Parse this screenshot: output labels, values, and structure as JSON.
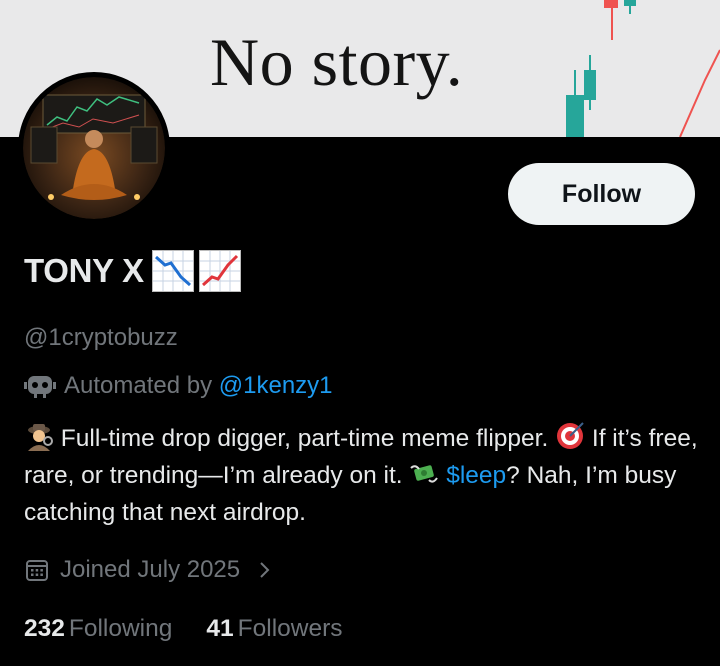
{
  "banner": {
    "text": "No story."
  },
  "profile": {
    "display_name": "TONY X",
    "name_emojis": [
      "chart-decreasing-icon",
      "chart-increasing-icon"
    ],
    "handle": "@1cryptobuzz",
    "automated_prefix": "Automated by",
    "automated_by": "@1kenzy1",
    "bio_part1": " Full-time drop digger, part-time meme flipper. ",
    "bio_part2": " If it’s free, rare, or trending—I’m already on it. ",
    "bio_link": "$leep",
    "bio_part3": "? Nah, I’m busy catching that next airdrop.",
    "joined": "Joined July 2025"
  },
  "actions": {
    "follow_label": "Follow"
  },
  "stats": {
    "following_count": "232",
    "following_label": "Following",
    "followers_count": "41",
    "followers_label": "Followers"
  },
  "colors": {
    "link": "#1d9bf0",
    "muted": "#71767b",
    "text": "#e7e9ea",
    "bg": "#000000"
  }
}
